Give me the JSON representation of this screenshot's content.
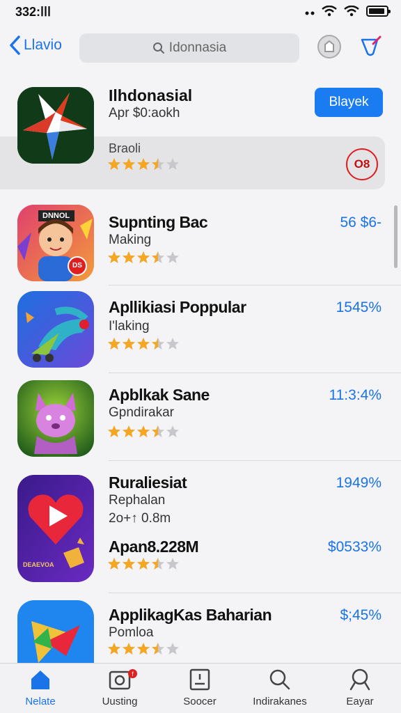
{
  "status_bar": {
    "time": "ااا:332"
  },
  "nav": {
    "back_label": "Llavio",
    "search_text": "Idonnasia"
  },
  "featured": {
    "title": "Ilhdonasial",
    "subtitle": "Apr $0:aokh",
    "genre": "Braoli",
    "rating": 3.5,
    "get_label": "Blayek",
    "badge": "O8"
  },
  "apps": [
    {
      "title": "Supnting Bac",
      "subtitle": "Making",
      "price": "56 $6-",
      "rating": 3.5
    },
    {
      "title": "Apllikiasi Poppular",
      "subtitle": "I'laking",
      "price": "1545%",
      "rating": 3.5
    },
    {
      "title": "Apblkak Sane",
      "subtitle": "Gpndirakar",
      "price": "11:3:4%",
      "rating": 3.5
    },
    {
      "title": "Ruraliesiat",
      "subtitle": "Rephalan",
      "detail": "2o+↑ 0.8m",
      "price": "1949%",
      "size_label": "Apan8.228M",
      "size_price": "$0533%",
      "rating": 3.5,
      "icon_text": "DEAEVOA"
    },
    {
      "title": "ApplikagKas Baharian",
      "subtitle": "Pomloa",
      "price": "$;45%",
      "rating": 3.5
    }
  ],
  "featured_icon_text": "DNNOL",
  "second_icon_badge": "DS",
  "tabs": [
    {
      "label": "Nelate",
      "icon": "home-icon"
    },
    {
      "label": "Uusting",
      "icon": "photo-icon",
      "badge": "f"
    },
    {
      "label": "Soocer",
      "icon": "id-card-icon"
    },
    {
      "label": "Indirakanes",
      "icon": "search-icon"
    },
    {
      "label": "Eayar",
      "icon": "search-icon"
    }
  ],
  "colors": {
    "accent": "#1a73e8",
    "button": "#1b7cf2",
    "star": "#f5a623",
    "badge_red": "#e02020"
  }
}
